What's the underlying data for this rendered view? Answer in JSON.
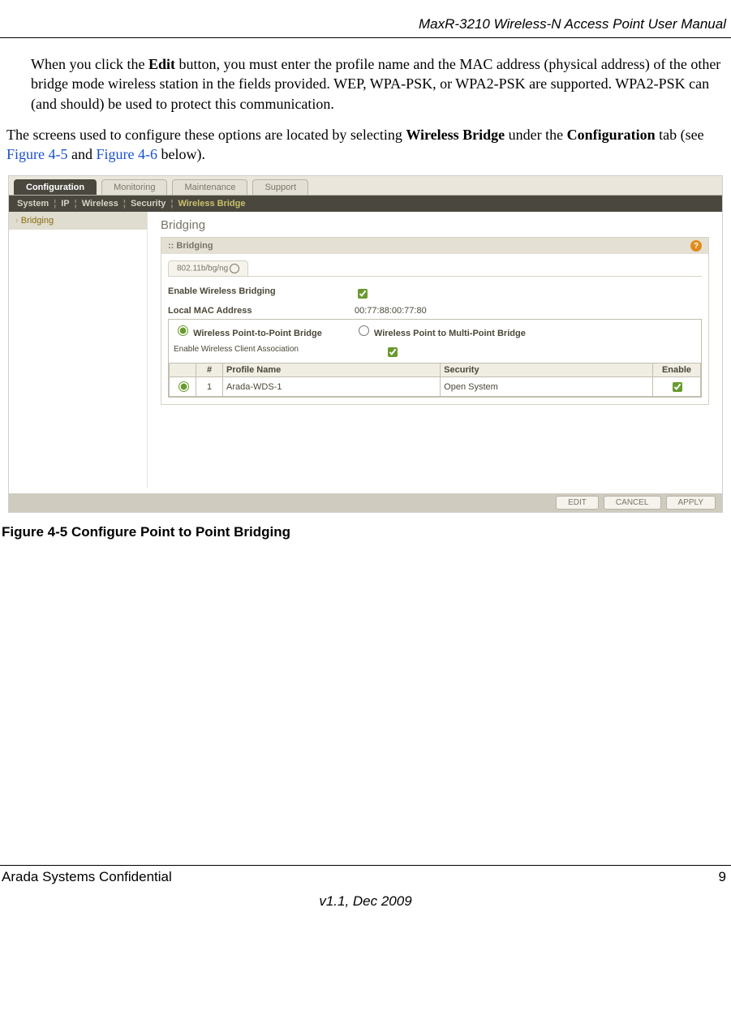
{
  "header": {
    "title": "MaxR-3210 Wireless-N Access Point User Manual"
  },
  "body": {
    "para1_pre": "When you click the ",
    "para1_b1": "Edit",
    "para1_post": " button, you must enter the profile name and the MAC address (physical address) of the other bridge mode wireless station in the fields provided. WEP, WPA-PSK, or WPA2-PSK are supported. WPA2-PSK can (and should) be used to protect this communication.",
    "para2_pre": "The screens used to configure these options are located by selecting ",
    "para2_b1": "Wireless Bridge",
    "para2_mid1": " under the ",
    "para2_b2": "Configuration",
    "para2_mid2": " tab (see ",
    "para2_link1": "Figure 4-5",
    "para2_mid3": " and ",
    "para2_link2": "Figure 4-6",
    "para2_post": " below)."
  },
  "screenshot": {
    "tabs": [
      "Configuration",
      "Monitoring",
      "Maintenance",
      "Support"
    ],
    "subnav": {
      "items": [
        "System",
        "IP",
        "Wireless",
        "Security"
      ],
      "active": "Wireless Bridge"
    },
    "sidebar": {
      "item": "Bridging"
    },
    "panel": {
      "title": "Bridging",
      "header": ":: Bridging",
      "inner_tab": "802.11b/bg/ng",
      "enable_label": "Enable Wireless Bridging",
      "mac_label": "Local MAC Address",
      "mac_value": "00:77:88:00:77:80",
      "radio1": "Wireless Point-to-Point Bridge",
      "radio2": "Wireless Point to Multi-Point Bridge",
      "assoc_label": "Enable Wireless Client Association",
      "table": {
        "col_num": "#",
        "col_profile": "Profile Name",
        "col_security": "Security",
        "col_enable": "Enable",
        "row_num": "1",
        "row_profile": "Arada-WDS-1",
        "row_security": "Open System"
      }
    },
    "buttons": {
      "edit": "EDIT",
      "cancel": "CANCEL",
      "apply": "APPLY"
    }
  },
  "caption": "Figure 4-5  Configure Point to Point Bridging",
  "footer": {
    "left": "Arada Systems Confidential",
    "right": "9",
    "version": "v1.1, Dec 2009"
  }
}
